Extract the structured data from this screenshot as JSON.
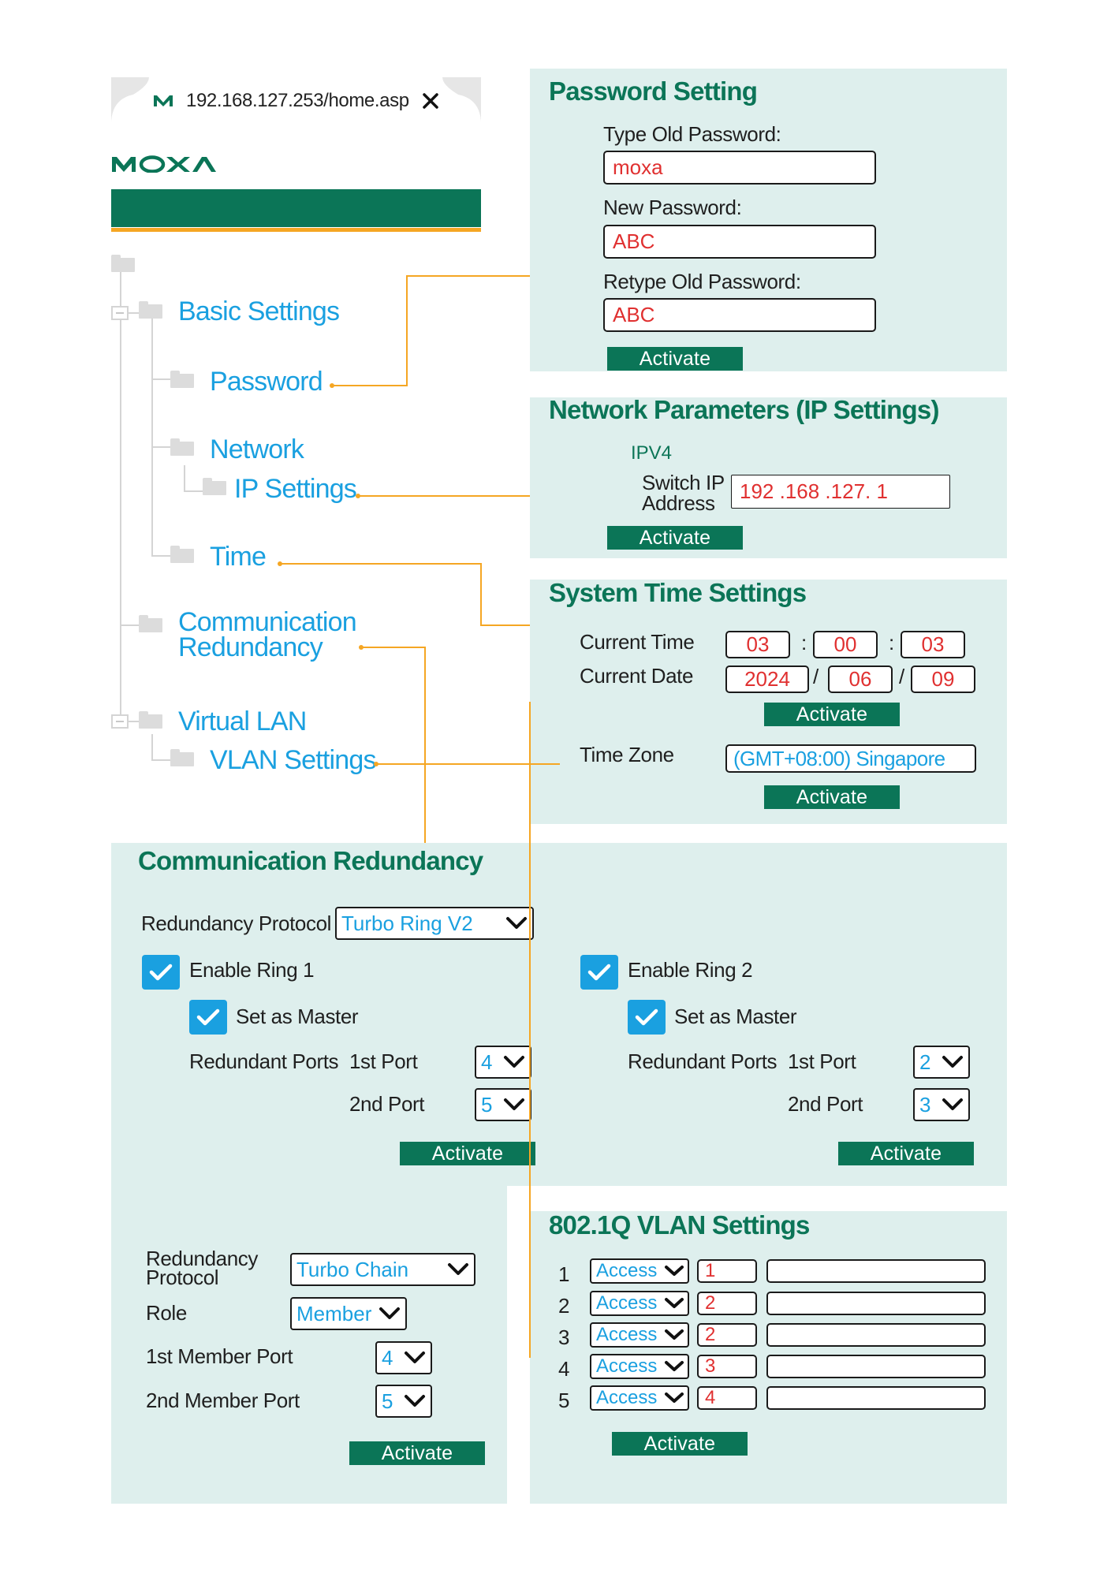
{
  "browser": {
    "url": "192.168.127.253/home.asp",
    "tab_icon": "moxa-m-icon",
    "close_icon": "close-icon"
  },
  "logo": {
    "text": "MOXA"
  },
  "colors": {
    "brand_green": "#0b7557",
    "accent_orange": "#f5a623",
    "link_blue": "#1aa0e0",
    "value_red": "#e03030",
    "panel_bg": "#deefed"
  },
  "tree": {
    "basic_settings": "Basic Settings",
    "password": "Password",
    "network": "Network",
    "ip_settings": "IP Settings",
    "time": "Time",
    "comm_redundancy_line1": "Communication",
    "comm_redundancy_line2": "Redundancy",
    "virtual_lan": "Virtual LAN",
    "vlan_settings": "VLAN Settings"
  },
  "password_panel": {
    "title": "Password Setting",
    "old_label": "Type Old Password:",
    "old_value": "moxa",
    "new_label": "New Password:",
    "new_value": "ABC",
    "retype_label": "Retype Old Password:",
    "retype_value": "ABC",
    "activate": "Activate"
  },
  "network_panel": {
    "title": "Network Parameters (IP Settings)",
    "ipv4": "IPV4",
    "switch_ip_line1": "Switch IP",
    "switch_ip_line2": "Address",
    "ip_value": "192 .168 .127. 1",
    "activate": "Activate"
  },
  "time_panel": {
    "title": "System Time Settings",
    "current_time_label": "Current Time",
    "hour": "03",
    "minute": "00",
    "second": "03",
    "current_date_label": "Current Date",
    "year": "2024",
    "month": "06",
    "day": "09",
    "time_sep": ":",
    "date_sep": "/",
    "activate1": "Activate",
    "time_zone_label": "Time Zone",
    "time_zone_value": "(GMT+08:00) Singapore",
    "activate2": "Activate"
  },
  "redundancy_panel": {
    "title": "Communication Redundancy",
    "protocol_label": "Redundancy Protocol",
    "protocol_value": "Turbo Ring V2",
    "ring1": {
      "enable_label": "Enable Ring 1",
      "master_label": "Set as Master",
      "ports_label": "Redundant Ports",
      "first_port_label": "1st Port",
      "first_port": "4",
      "second_port_label": "2nd Port",
      "second_port": "5",
      "activate": "Activate"
    },
    "ring2": {
      "enable_label": "Enable Ring 2",
      "master_label": "Set as Master",
      "ports_label": "Redundant Ports",
      "first_port_label": "1st Port",
      "first_port": "2",
      "second_port_label": "2nd Port",
      "second_port": "3",
      "activate": "Activate"
    }
  },
  "chain_panel": {
    "protocol_label_line1": "Redundancy",
    "protocol_label_line2": "Protocol",
    "protocol_value": "Turbo Chain",
    "role_label": "Role",
    "role_value": "Member",
    "first_member_label": "1st Member Port",
    "first_member_value": "4",
    "second_member_label": "2nd Member Port",
    "second_member_value": "5",
    "activate": "Activate"
  },
  "vlan_panel": {
    "title": "802.1Q VLAN Settings",
    "rows": [
      {
        "port": "1",
        "mode": "Access",
        "pvid": "1",
        "tagged": ""
      },
      {
        "port": "2",
        "mode": "Access",
        "pvid": "2",
        "tagged": ""
      },
      {
        "port": "3",
        "mode": "Access",
        "pvid": "2",
        "tagged": ""
      },
      {
        "port": "4",
        "mode": "Access",
        "pvid": "3",
        "tagged": ""
      },
      {
        "port": "5",
        "mode": "Access",
        "pvid": "4",
        "tagged": ""
      }
    ],
    "activate": "Activate"
  }
}
